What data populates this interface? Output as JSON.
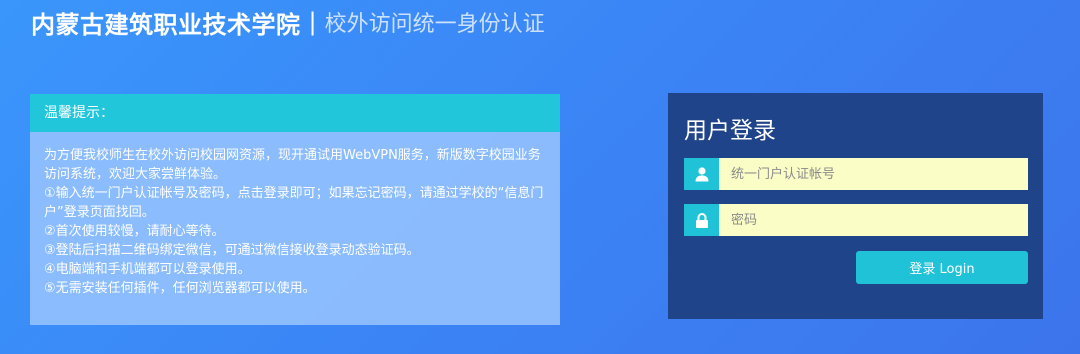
{
  "header": {
    "school_name": "内蒙古建筑职业技术学院",
    "separator": "|",
    "subtitle": "校外访问统一身份认证"
  },
  "notice": {
    "title": "温馨提示：",
    "paragraphs": [
      "为方便我校师生在校外访问校园网资源，现开通试用WebVPN服务，新版数字校园业务访问系统，欢迎大家尝鲜体验。",
      "①输入统一门户认证帐号及密码，点击登录即可；如果忘记密码，请通过学校的“信息门户”登录页面找回。",
      "②首次使用较慢，请耐心等待。",
      "③登陆后扫描二维码绑定微信，可通过微信接收登录动态验证码。",
      "④电脑端和手机端都可以登录使用。",
      "⑤无需安装任何插件，任何浏览器都可以使用。"
    ]
  },
  "login": {
    "title": "用户登录",
    "username_placeholder": "统一门户认证帐号",
    "password_placeholder": "密码",
    "submit_label": "登录 Login",
    "user_icon": "user-icon",
    "lock_icon": "lock-icon"
  },
  "colors": {
    "accent": "#22c6da",
    "login_panel": "#1f4489",
    "input_bg": "#fafdc5"
  }
}
